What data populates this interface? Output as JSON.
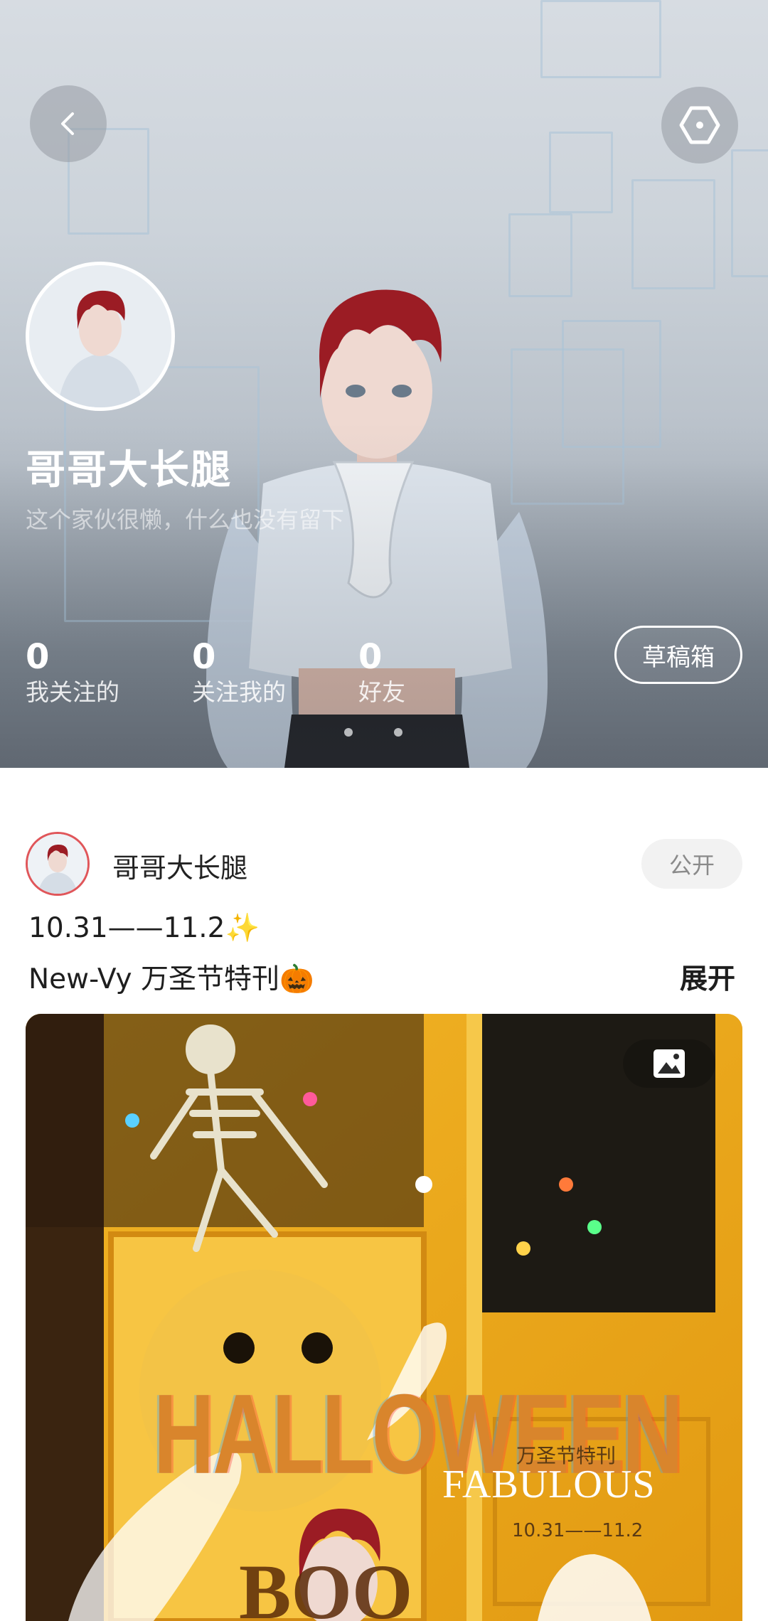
{
  "profile": {
    "username": "哥哥大长腿",
    "bio": "这个家伙很懒，什么也没有留下",
    "stats": [
      {
        "value": "0",
        "label": "我关注的"
      },
      {
        "value": "0",
        "label": "关注我的"
      },
      {
        "value": "0",
        "label": "好友"
      }
    ],
    "drafts_label": "草稿箱"
  },
  "post": {
    "author": "哥哥大长腿",
    "visibility": "公开",
    "line1": "10.31——11.2✨",
    "line2": "New-Vy 万圣节特刊🎃",
    "expand_label": "展开",
    "image": {
      "title_text": "HALLOWEEN",
      "cn_text": "万圣节特刊",
      "fab_text": "FABULOUS",
      "date_text": "10.31——11.2"
    }
  },
  "icons": {
    "back": "chevron-left-icon",
    "settings": "hexagon-settings-icon",
    "image_type": "image-icon"
  },
  "colors": {
    "accent_red": "#e0565a",
    "poster_orange": "#e2a020"
  }
}
